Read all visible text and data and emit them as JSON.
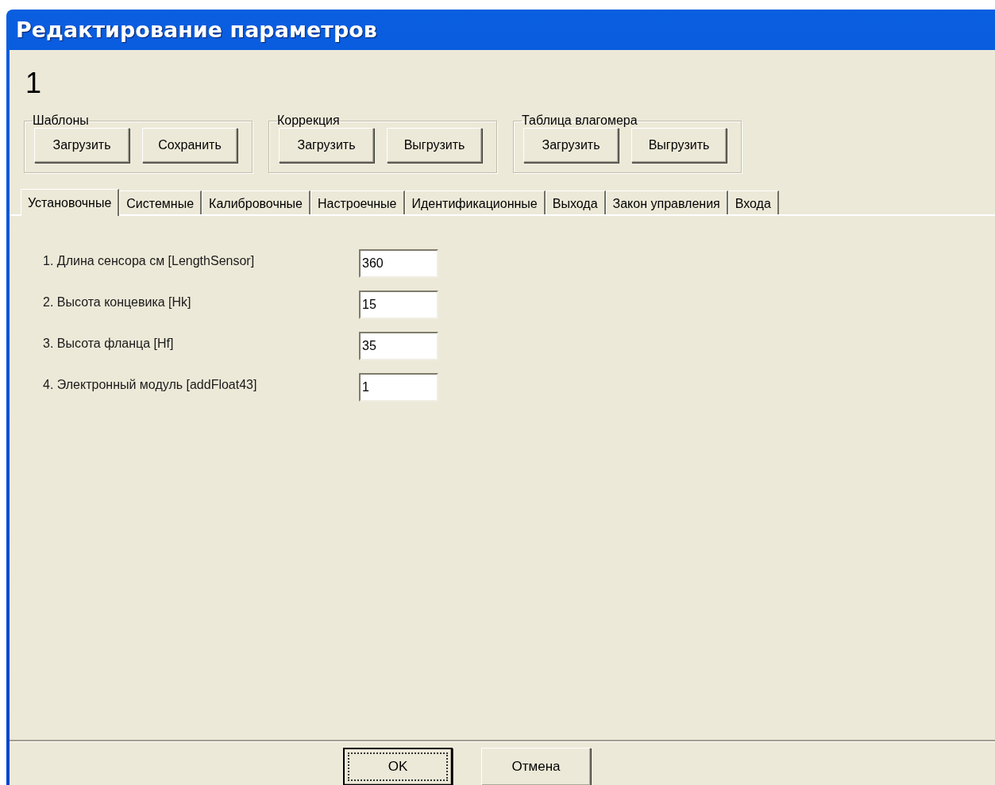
{
  "window": {
    "title": "Редактирование параметров"
  },
  "header": "1",
  "groups": [
    {
      "title": "Шаблоны",
      "buttons": [
        "Загрузить",
        "Сохранить"
      ]
    },
    {
      "title": "Коррекция",
      "buttons": [
        "Загрузить",
        "Выгрузить"
      ]
    },
    {
      "title": "Таблица влагомера",
      "buttons": [
        "Загрузить",
        "Выгрузить"
      ]
    }
  ],
  "tabs": [
    {
      "label": "Установочные",
      "selected": true
    },
    {
      "label": "Системные",
      "selected": false
    },
    {
      "label": "Калибровочные",
      "selected": false
    },
    {
      "label": "Настроечные",
      "selected": false
    },
    {
      "label": "Идентификационные",
      "selected": false
    },
    {
      "label": "Выхода",
      "selected": false
    },
    {
      "label": "Закон управления",
      "selected": false
    },
    {
      "label": "Входа",
      "selected": false
    }
  ],
  "fields": [
    {
      "label": "1. Длина сенсора см [LengthSensor]",
      "value": "360"
    },
    {
      "label": "2. Высота концевика [Hk]",
      "value": "15"
    },
    {
      "label": "3. Высота фланца [Hf]",
      "value": "35"
    },
    {
      "label": "4. Электронный модуль [addFloat43]",
      "value": "1"
    }
  ],
  "buttons": [
    {
      "label": "OK",
      "default": true
    },
    {
      "label": "Отмена",
      "default": false
    }
  ]
}
